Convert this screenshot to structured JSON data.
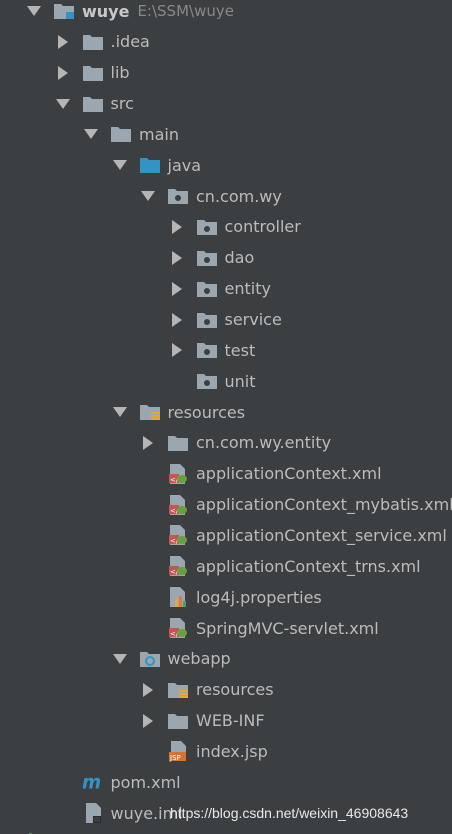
{
  "colors": {
    "background": "#3c3f41",
    "folder": "#9aa7b0",
    "source_folder": "#3592c4",
    "text": "#bbbbbb"
  },
  "project": {
    "name": "wuye",
    "path": "E:\\SSM\\wuye"
  },
  "tree": [
    {
      "label": "wuye",
      "arrow": "down",
      "icon": "module-folder-icon",
      "level": 0
    },
    {
      "label": ".idea",
      "arrow": "right",
      "icon": "folder-icon",
      "level": 1
    },
    {
      "label": "lib",
      "arrow": "right",
      "icon": "folder-icon",
      "level": 1
    },
    {
      "label": "src",
      "arrow": "down",
      "icon": "folder-icon",
      "level": 1
    },
    {
      "label": "main",
      "arrow": "down",
      "icon": "folder-icon",
      "level": 2
    },
    {
      "label": "java",
      "arrow": "down",
      "icon": "source-folder-icon",
      "level": 3
    },
    {
      "label": "cn.com.wy",
      "arrow": "down",
      "icon": "package-icon",
      "level": 4
    },
    {
      "label": "controller",
      "arrow": "right",
      "icon": "package-icon",
      "level": 5
    },
    {
      "label": "dao",
      "arrow": "right",
      "icon": "package-icon",
      "level": 5
    },
    {
      "label": "entity",
      "arrow": "right",
      "icon": "package-icon",
      "level": 5
    },
    {
      "label": "service",
      "arrow": "right",
      "icon": "package-icon",
      "level": 5
    },
    {
      "label": "test",
      "arrow": "right",
      "icon": "package-icon",
      "level": 5
    },
    {
      "label": "unit",
      "arrow": "none",
      "icon": "package-icon",
      "level": 5
    },
    {
      "label": "resources",
      "arrow": "down",
      "icon": "resources-folder-icon",
      "level": 3
    },
    {
      "label": "cn.com.wy.entity",
      "arrow": "right",
      "icon": "folder-icon",
      "level": 4
    },
    {
      "label": "applicationContext.xml",
      "arrow": "none",
      "icon": "spring-xml-icon",
      "level": 4
    },
    {
      "label": "applicationContext_mybatis.xml",
      "arrow": "none",
      "icon": "spring-xml-icon",
      "level": 4
    },
    {
      "label": "applicationContext_service.xml",
      "arrow": "none",
      "icon": "spring-xml-icon",
      "level": 4
    },
    {
      "label": "applicationContext_trns.xml",
      "arrow": "none",
      "icon": "spring-xml-icon",
      "level": 4
    },
    {
      "label": "log4j.properties",
      "arrow": "none",
      "icon": "properties-file-icon",
      "level": 4
    },
    {
      "label": "SpringMVC-servlet.xml",
      "arrow": "none",
      "icon": "spring-xml-icon",
      "level": 4
    },
    {
      "label": "webapp",
      "arrow": "down",
      "icon": "web-folder-icon",
      "level": 3
    },
    {
      "label": "resources",
      "arrow": "right",
      "icon": "resources-folder-icon",
      "level": 4
    },
    {
      "label": "WEB-INF",
      "arrow": "right",
      "icon": "folder-icon",
      "level": 4
    },
    {
      "label": "index.jsp",
      "arrow": "none",
      "icon": "jsp-file-icon",
      "level": 4
    },
    {
      "label": "pom.xml",
      "arrow": "none",
      "icon": "maven-pom-icon",
      "level": 1
    },
    {
      "label": "wuye.iml",
      "arrow": "none",
      "icon": "iml-file-icon",
      "level": 1
    }
  ],
  "watermark": "https://blog.csdn.net/weixin_46908643"
}
